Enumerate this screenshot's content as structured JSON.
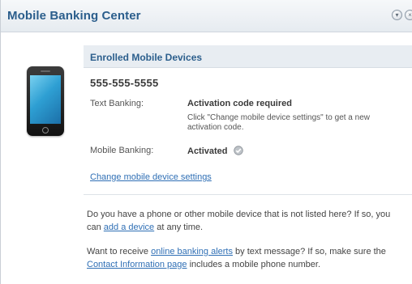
{
  "header": {
    "title": "Mobile Banking Center",
    "collapse_icon": "chevron-down-icon",
    "close_icon": "close-icon"
  },
  "device_image": "mobile-phone-icon",
  "section": {
    "title": "Enrolled Mobile Devices"
  },
  "device": {
    "phone_number": "555-555-5555",
    "text_banking_label": "Text Banking:",
    "text_banking_value": "Activation code required",
    "text_banking_note": "Click \"Change mobile device settings\" to get a new activation code.",
    "mobile_banking_label": "Mobile Banking:",
    "mobile_banking_value": "Activated",
    "activated_icon": "check-icon"
  },
  "links": {
    "change_settings": "Change mobile device settings"
  },
  "info": {
    "p1_before": "Do you have a phone or other mobile device that is not listed here? If so, you can ",
    "p1_link": "add a device",
    "p1_after": " at any time.",
    "p2_before": "Want to receive ",
    "p2_link1": "online banking alerts",
    "p2_mid": " by text message? If so, make sure the ",
    "p2_link2": "Contact Information page",
    "p2_after": " includes a mobile phone number."
  },
  "colors": {
    "title_blue": "#2b5e8c",
    "link_blue": "#2f6fb5",
    "section_bar": "#e8edf2"
  }
}
